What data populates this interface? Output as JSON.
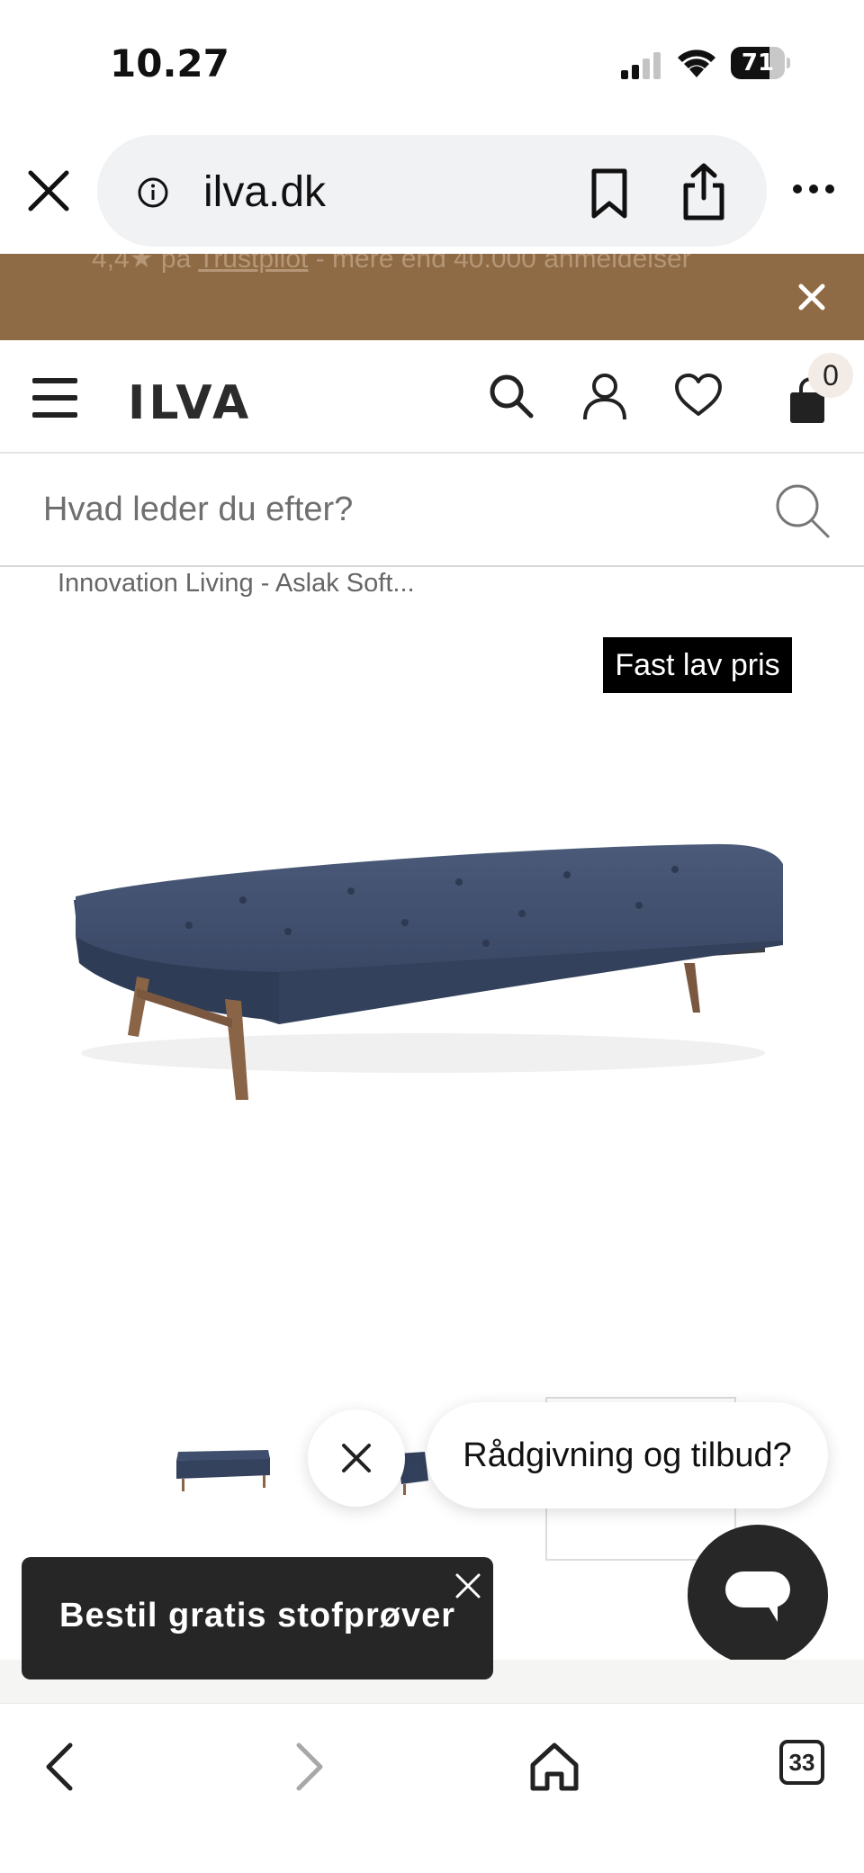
{
  "status_bar": {
    "time": "10.27",
    "battery_level": "71",
    "battery_fraction": 0.71
  },
  "browser": {
    "url": "ilva.dk"
  },
  "promo": {
    "text_prefix": "4,4★ på ",
    "link": "Trustpilot",
    "text_suffix": " - mere end 40.000 anmeldelser"
  },
  "header": {
    "logo": "ILVA",
    "cart_count": "0"
  },
  "search": {
    "placeholder": "Hvad leder du efter?"
  },
  "breadcrumb": "Innovation Living - Aslak Soft...",
  "product": {
    "badge": "Fast lav pris"
  },
  "chat": {
    "bubble": "Rådgivning og tilbud?"
  },
  "samples_banner": {
    "label": "Bestil gratis stofprøver"
  },
  "toolbar": {
    "tabs_count": "33"
  },
  "colors": {
    "promo_bg": "#8e6a45",
    "dark": "#262626",
    "sofa_blue": "#3d4d6b",
    "wood": "#8a6446"
  }
}
